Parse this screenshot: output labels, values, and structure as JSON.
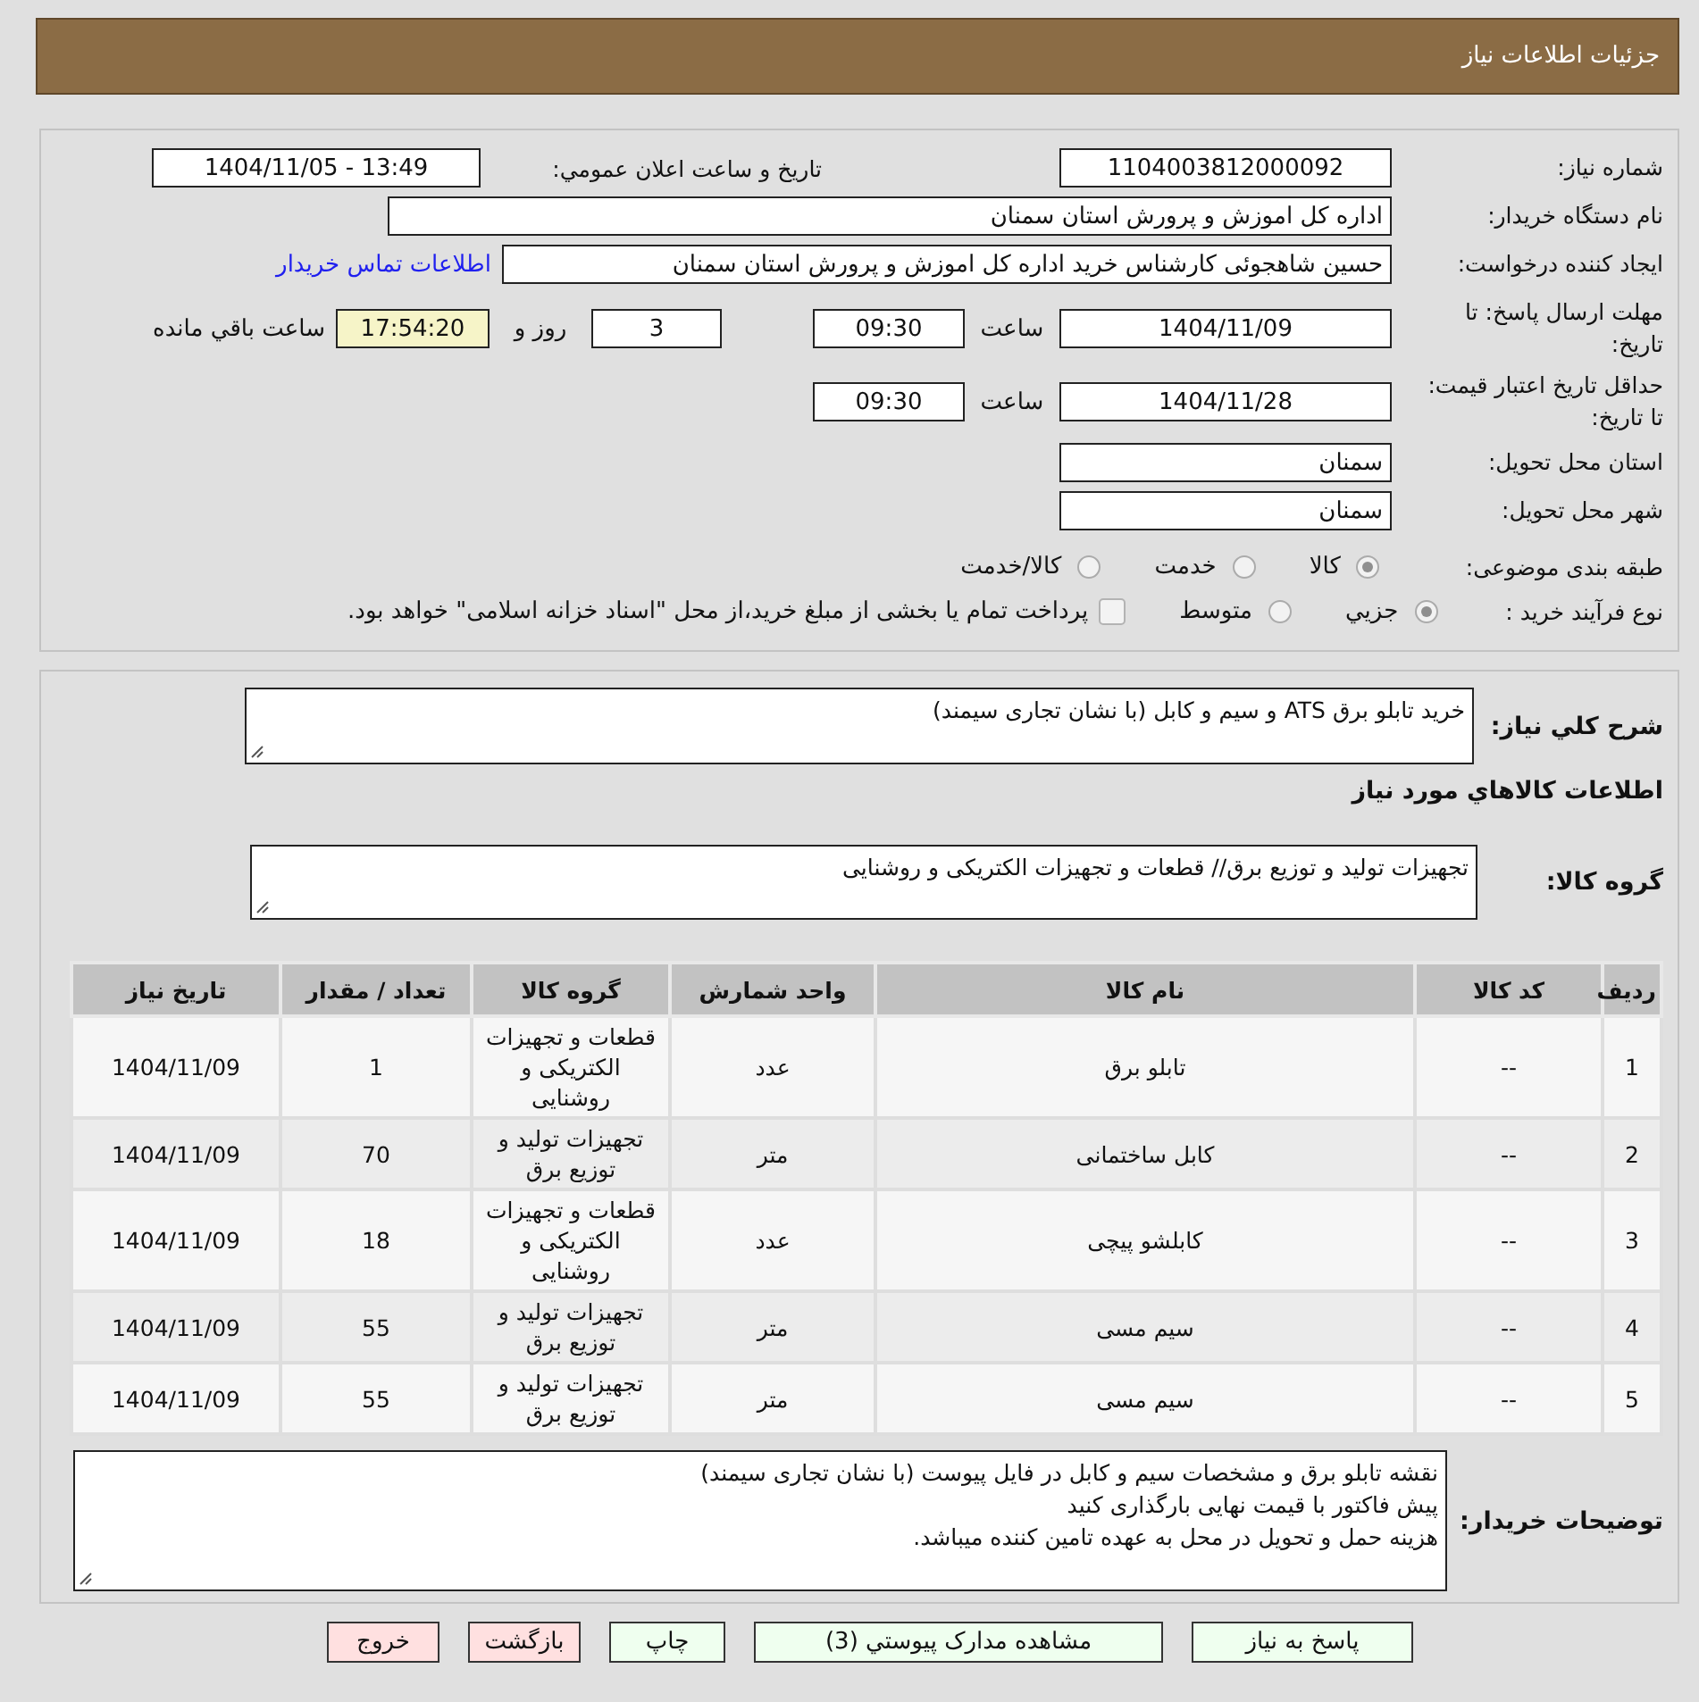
{
  "header": {
    "title": "جزئيات اطلاعات نياز"
  },
  "details": {
    "need_number": {
      "label": "شماره نياز:",
      "value": "1104003812000092"
    },
    "announcement": {
      "label": "تاريخ و ساعت اعلان عمومي:",
      "value": "1404/11/05 - 13:49"
    },
    "buyer_org": {
      "label": "نام دستگاه خريدار:",
      "value": "اداره کل اموزش و پرورش استان سمنان"
    },
    "requester": {
      "label": "ايجاد کننده درخواست:",
      "value": "حسين شاهجوئی کارشناس خريد اداره کل اموزش و پرورش استان سمنان",
      "link": "اطلاعات تماس خريدار"
    },
    "response_deadline": {
      "label": "مهلت ارسال پاسخ: تا تاريخ:",
      "date": "1404/11/09",
      "time_label": "ساعت",
      "time": "09:30",
      "days": "3",
      "days_label": "روز و",
      "remaining": "17:54:20",
      "remaining_label": "ساعت باقي مانده"
    },
    "price_validity": {
      "label": "حداقل تاريخ اعتبار قيمت: تا تاريخ:",
      "date": "1404/11/28",
      "time_label": "ساعت",
      "time": "09:30"
    },
    "delivery_province": {
      "label": "استان محل تحويل:",
      "value": "سمنان"
    },
    "delivery_city": {
      "label": "شهر محل تحويل:",
      "value": "سمنان"
    },
    "category": {
      "label": "طبقه بندی موضوعی:",
      "options": [
        {
          "label": "کالا",
          "selected": true
        },
        {
          "label": "خدمت",
          "selected": false
        },
        {
          "label": "کالا/خدمت",
          "selected": false
        }
      ]
    },
    "process": {
      "label": "نوع فرآيند خريد :",
      "options": [
        {
          "kind": "radio",
          "label": "جزيي",
          "selected": true
        },
        {
          "kind": "radio",
          "label": "متوسط",
          "selected": false
        },
        {
          "kind": "checkbox",
          "label": "پرداخت تمام يا بخشی از مبلغ خريد،از محل \"اسناد خزانه اسلامی\" خواهد بود.",
          "checked": false
        }
      ]
    }
  },
  "needs": {
    "summary": {
      "label": "شرح کلي نياز:",
      "value": "خريد تابلو برق ATS و سيم و کابل (با نشان تجاری سيمند)"
    },
    "goods_heading": "اطلاعات کالاهاي مورد نياز",
    "goods_group": {
      "label": "گروه کالا:",
      "value": "تجهيزات توليد و توزيع برق// قطعات و تجهيزات الکتريکی و روشنايی"
    },
    "table": {
      "columns": [
        "ردیف",
        "کد کالا",
        "نام کالا",
        "واحد شمارش",
        "گروه کالا",
        "تعداد / مقدار",
        "تاريخ نياز"
      ],
      "rows": [
        [
          "1",
          "--",
          "تابلو برق",
          "عدد",
          "قطعات و تجهيزات الکتريکی و روشنايی",
          "1",
          "1404/11/09"
        ],
        [
          "2",
          "--",
          "کابل ساختمانی",
          "متر",
          "تجهيزات توليد و توزيع برق",
          "70",
          "1404/11/09"
        ],
        [
          "3",
          "--",
          "کابلشو پيچی",
          "عدد",
          "قطعات و تجهيزات الکتريکی و روشنايی",
          "18",
          "1404/11/09"
        ],
        [
          "4",
          "--",
          "سيم مسی",
          "متر",
          "تجهيزات توليد و توزيع برق",
          "55",
          "1404/11/09"
        ],
        [
          "5",
          "--",
          "سيم مسی",
          "متر",
          "تجهيزات توليد و توزيع برق",
          "55",
          "1404/11/09"
        ]
      ]
    },
    "buyer_notes": {
      "label": "توضيحات خريدار:",
      "value": "نقشه تابلو برق و مشخصات سيم و کابل در فايل پيوست (با نشان تجاری سيمند)\nپيش فاکتور با قيمت نهايی بارگذاری کنيد\nهزينه حمل و تحويل در محل به عهده تامين کننده ميباشد."
    }
  },
  "buttons": [
    {
      "label": "پاسخ به نياز",
      "kind": "action"
    },
    {
      "label": "مشاهده مدارک پيوستي (3)",
      "kind": "action"
    },
    {
      "label": "چاپ",
      "kind": "action"
    },
    {
      "label": "بازگشت",
      "kind": "exit"
    },
    {
      "label": "خروج",
      "kind": "exit"
    }
  ]
}
